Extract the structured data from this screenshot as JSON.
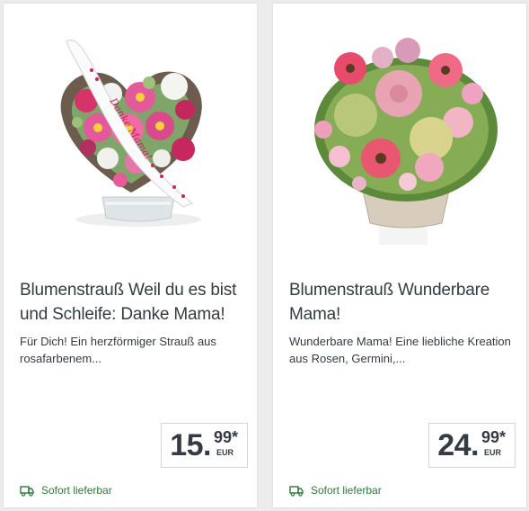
{
  "products": [
    {
      "image_alt": "heart-shaped-bouquet-with-ribbon",
      "ribbon_text": "Danke Mama!",
      "title": "Blumenstrauß Weil du es bist und Schleife: Danke Mama!",
      "description": "Für Dich! Ein herzförmiger Strauß aus rosafarbenem...",
      "price_int": "15.",
      "price_dec": "99*",
      "currency": "EUR",
      "delivery": "Sofort lieferbar"
    },
    {
      "image_alt": "round-pink-bouquet-in-pot",
      "title": "Blumenstrauß Wunderbare Mama!",
      "description": "Wunderbare Mama! Eine liebliche Kreation aus Rosen, Germini,...",
      "price_int": "24.",
      "price_dec": "99*",
      "currency": "EUR",
      "delivery": "Sofort lieferbar"
    }
  ],
  "colors": {
    "background": "#ececec",
    "card": "#ffffff",
    "text": "#353b42",
    "delivery_green": "#2c7a3a",
    "price_border": "#d6d6d6"
  }
}
